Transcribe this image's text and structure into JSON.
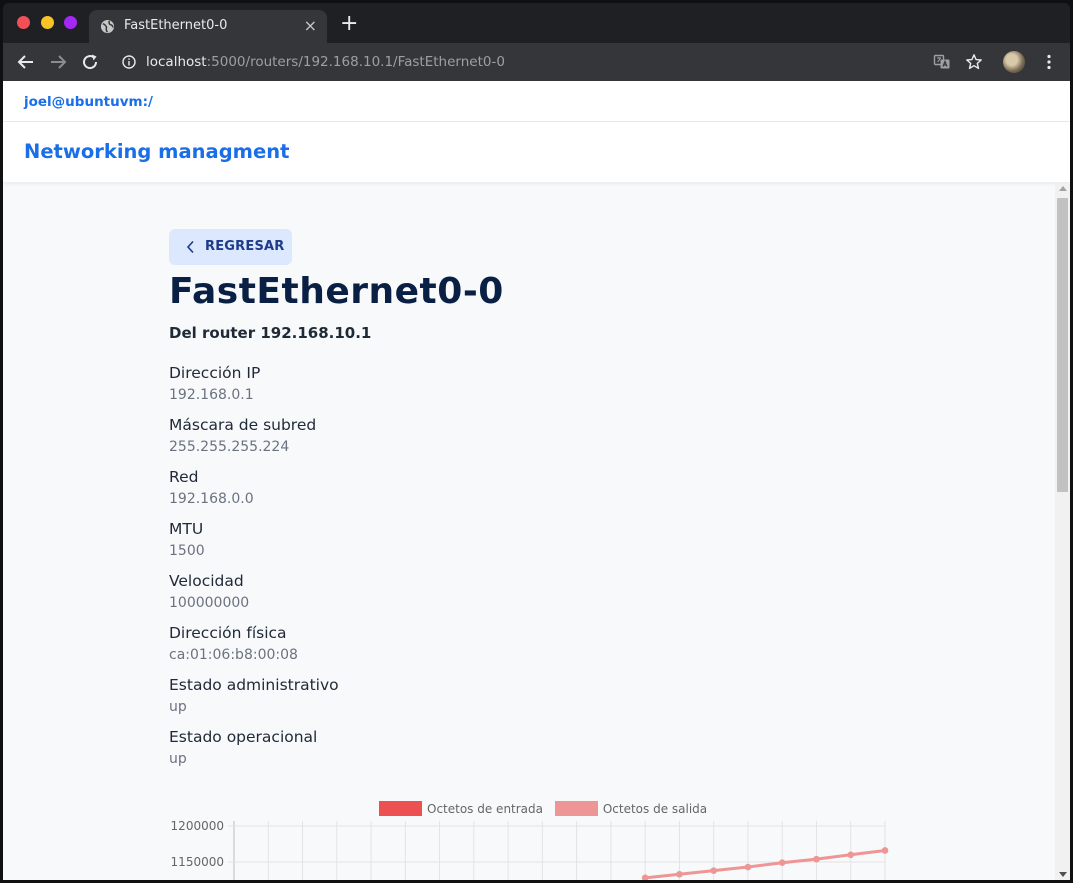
{
  "browser": {
    "tab_title": "FastEthernet0-0",
    "tab_close": "×",
    "new_tab": "+",
    "url_host": "localhost",
    "url_path": ":5000/routers/192.168.10.1/FastEthernet0-0"
  },
  "topbar": {
    "user": "joel@ubuntuvm:/"
  },
  "navbar": {
    "brand": "Networking managment"
  },
  "page": {
    "back_label": "REGRESAR",
    "title": "FastEthernet0-0",
    "subtitle": "Del router 192.168.10.1",
    "fields": [
      {
        "label": "Dirección IP",
        "value": "192.168.0.1"
      },
      {
        "label": "Máscara de subred",
        "value": "255.255.255.224"
      },
      {
        "label": "Red",
        "value": "192.168.0.0"
      },
      {
        "label": "MTU",
        "value": "1500"
      },
      {
        "label": "Velocidad",
        "value": "100000000"
      },
      {
        "label": "Dirección física",
        "value": "ca:01:06:b8:00:08"
      },
      {
        "label": "Estado administrativo",
        "value": "up"
      },
      {
        "label": "Estado operacional",
        "value": "up"
      }
    ]
  },
  "colors": {
    "accent": "#1a6ee8",
    "series_in": "#ec5050",
    "series_out": "#ee9595"
  },
  "chart_data": {
    "type": "line",
    "legend": [
      "Octetos de entrada",
      "Octetos de salida"
    ],
    "yticks": [
      "1200000",
      "1150000"
    ],
    "ylim": [
      1100000,
      1200000
    ],
    "grid": true,
    "series": [
      {
        "name": "Octetos de salida",
        "values": [
          1128000,
          1133000,
          1138000,
          1143000,
          1149000,
          1154000,
          1160000,
          1166000
        ]
      }
    ]
  }
}
